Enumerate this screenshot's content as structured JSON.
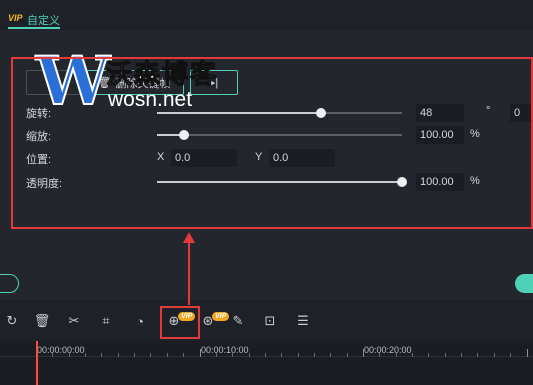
{
  "tab": {
    "vip_badge": "VIP",
    "label": "自定义"
  },
  "keyframe": {
    "delete_label": "删除关键帧",
    "next_label": "▸|"
  },
  "watermark": {
    "logo_letter": "W",
    "name": "沃森博客",
    "url": "wosn.net"
  },
  "properties": {
    "rotate": {
      "label": "旋转:",
      "value": "48",
      "unit": "°",
      "extra_value": "0",
      "level_percent": 67
    },
    "scale": {
      "label": "缩放:",
      "value": "100.00",
      "unit": "%",
      "level_percent": 11
    },
    "position": {
      "label": "位置:",
      "x_label": "X",
      "x_value": "0.0",
      "y_label": "Y",
      "y_value": "0.0"
    },
    "opacity": {
      "label": "透明度:",
      "value": "100.00",
      "unit": "%",
      "level_percent": 100
    }
  },
  "toolbar": {
    "items": [
      {
        "name": "redo-icon",
        "glyph": "↻"
      },
      {
        "name": "delete-icon",
        "glyph": "🗑"
      },
      {
        "name": "cut-icon",
        "glyph": "✂"
      },
      {
        "name": "crop-icon",
        "glyph": "⌗"
      },
      {
        "name": "speed-icon",
        "glyph": "◔"
      },
      {
        "name": "stabilize-icon",
        "glyph": "⊕",
        "vip": "VIP"
      },
      {
        "name": "color-match-icon",
        "glyph": "⊛",
        "vip": "VIP"
      },
      {
        "name": "eyedropper-icon",
        "glyph": "✎"
      },
      {
        "name": "export-frame-icon",
        "glyph": "⊡"
      },
      {
        "name": "adjust-icon",
        "glyph": "☰"
      }
    ]
  },
  "timeline": {
    "labels": [
      "00:00:00:00",
      "00:00:10:00",
      "00:00:20:00"
    ]
  },
  "colors": {
    "accent": "#4fd1b5",
    "vip": "#f5a623",
    "highlight": "#e23a3a"
  }
}
